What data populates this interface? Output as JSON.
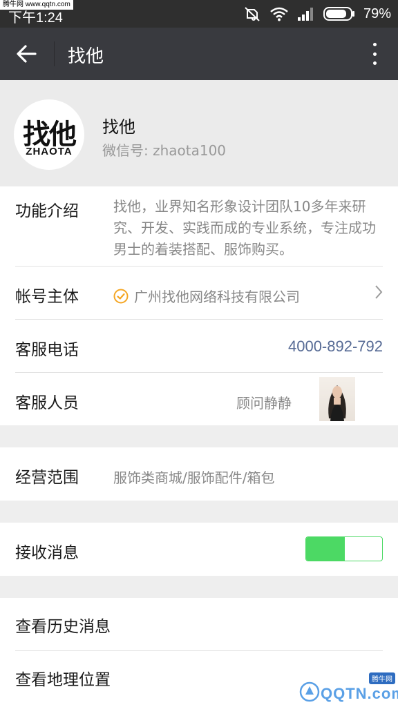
{
  "status_bar": {
    "watermark": "腾牛网 www.qqtn.com",
    "time": "下午1:24",
    "battery": "79%"
  },
  "title_bar": {
    "title": "找他"
  },
  "profile": {
    "logo_cn": "找他",
    "logo_en": "ZHAOTA",
    "name": "找他",
    "wechat_id": "微信号: zhaota100"
  },
  "info": {
    "intro_label": "功能介绍",
    "intro_text": "找他，业界知名形象设计团队10多年来研究、开发、实践而成的专业系统，专注成功男士的着装搭配、服饰购买。",
    "account_label": "帐号主体",
    "account_value": "广州找他网络科技有限公司",
    "phone_label": "客服电话",
    "phone_value": "4000-892-792",
    "agent_label": "客服人员",
    "agent_name": "顾问静静"
  },
  "scope": {
    "label": "经营范围",
    "value": "服饰类商城/服饰配件/箱包"
  },
  "receive": {
    "label": "接收消息",
    "enabled": true
  },
  "actions": {
    "history": "查看历史消息",
    "location": "查看地理位置"
  },
  "watermark_bottom": {
    "badge": "腾牛网",
    "text": "QQTN.com"
  },
  "colors": {
    "title_bar": "#393a3f",
    "link": "#576b95",
    "toggle_on": "#4cd964",
    "verified": "#f5a623"
  }
}
